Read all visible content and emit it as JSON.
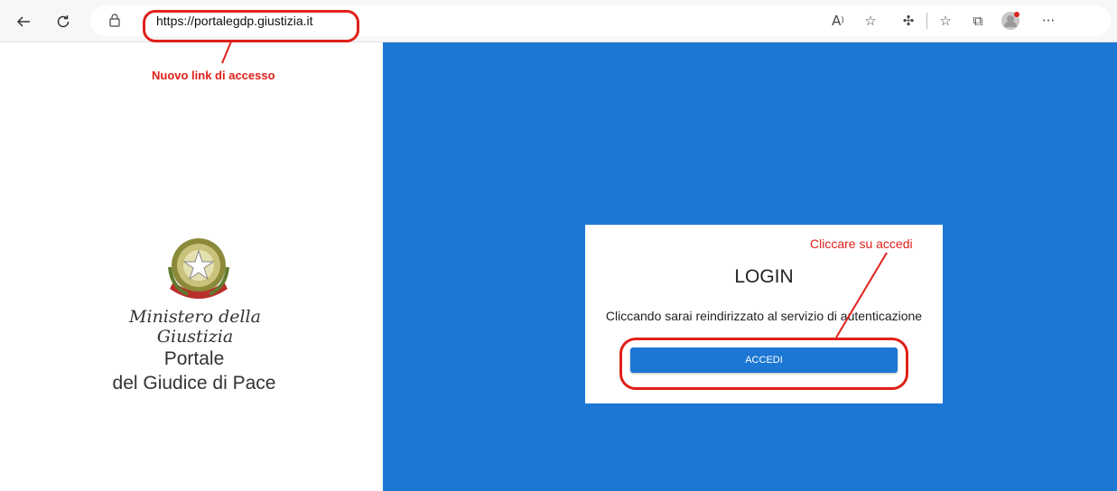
{
  "browser": {
    "url": "https://portalegdp.giustizia.it",
    "icons": [
      "back-icon",
      "refresh-icon",
      "lock-icon",
      "read-aloud-icon",
      "add-favorite-icon",
      "extensions-icon",
      "favorites-icon",
      "collections-icon",
      "profile-avatar",
      "more-icon"
    ]
  },
  "annotations": {
    "url_note": "Nuovo link di accesso",
    "button_note": "Cliccare su accedi",
    "color": "#e0201b"
  },
  "left": {
    "ministry": "Ministero della Giustizia",
    "portal_line1": "Portale",
    "portal_line2": "del Giudice di Pace"
  },
  "login": {
    "title": "LOGIN",
    "description": "Cliccando sarai reindirizzato al servizio di autenticazione",
    "button_label": "ACCEDI"
  },
  "colors": {
    "brand_blue": "#1c77d4"
  }
}
